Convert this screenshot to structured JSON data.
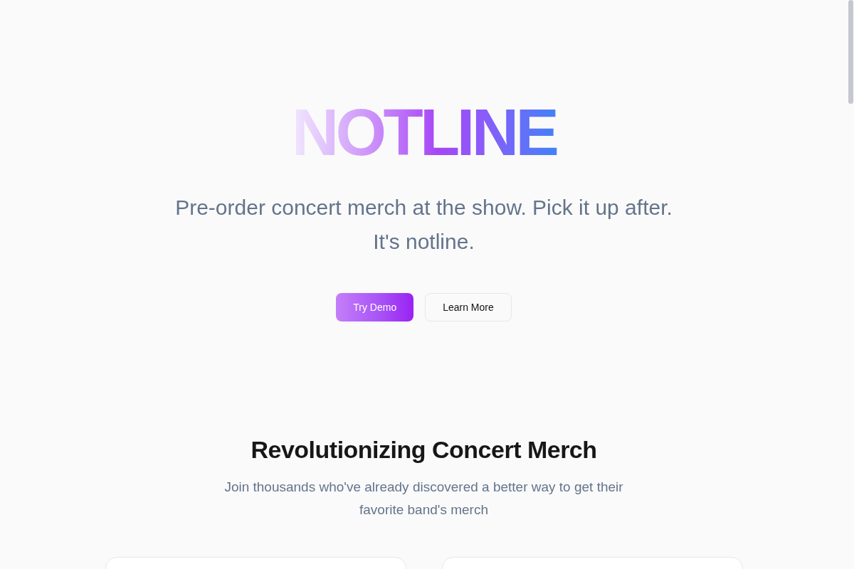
{
  "hero": {
    "title": "NOTLINE",
    "tagline": "Pre-order concert merch at the show. Pick it up after. It's notline.",
    "buttons": [
      {
        "label": "Try Demo",
        "kind": "primary"
      },
      {
        "label": "Learn More",
        "kind": "secondary"
      }
    ]
  },
  "section": {
    "heading": "Revolutionizing Concert Merch",
    "subheading": "Join thousands who've already discovered a better way to get their favorite band's merch"
  }
}
